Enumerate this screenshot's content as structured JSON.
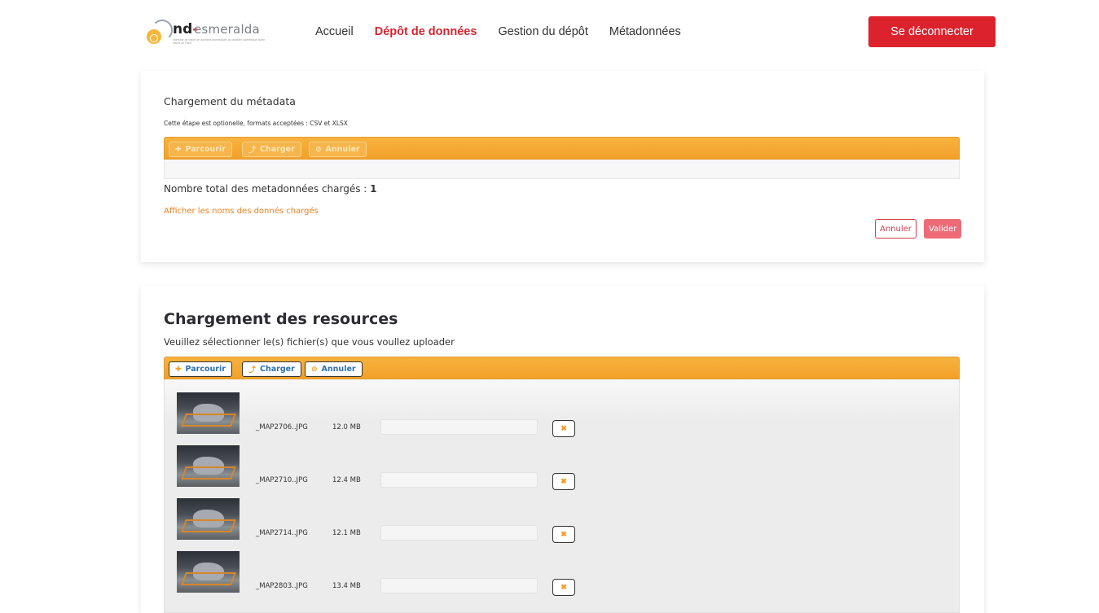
{
  "header": {
    "logo": {
      "prefix": "nd",
      "dash": "-",
      "name": "esmeralda",
      "tagline": "Interface de dépôt de données numériques du chantier scientifique Notre-Dame de Paris"
    },
    "nav": [
      {
        "label": "Accueil",
        "active": false
      },
      {
        "label": "Dépôt de données",
        "active": true
      },
      {
        "label": "Gestion du dépôt",
        "active": false
      },
      {
        "label": "Métadonnées",
        "active": false
      }
    ],
    "logout_label": "Se déconnecter"
  },
  "metadata_section": {
    "title": "Chargement du métadata",
    "hint": "Cette étape est optionelle, formats acceptées : CSV et XLSX",
    "toolbar": {
      "browse_label": "Parcourir",
      "upload_label": "Charger",
      "cancel_label": "Annuler"
    },
    "total_label": "Nombre total des metadonnées chargés :",
    "total_count": "1",
    "show_names_link": "Afficher les noms des donnés chargés",
    "cancel_button": "Annuler",
    "validate_button": "Valider"
  },
  "resources_section": {
    "title": "Chargement des resources",
    "hint": "Veuillez sélectionner le(s) fichier(s) que vous voullez uploader",
    "toolbar": {
      "browse_label": "Parcourir",
      "upload_label": "Charger",
      "cancel_label": "Annuler"
    },
    "files": [
      {
        "name": "_MAP2706..JPG",
        "size": "12.0 MB",
        "progress": 0
      },
      {
        "name": "_MAP2710..JPG",
        "size": "12.4 MB",
        "progress": 0
      },
      {
        "name": "_MAP2714..JPG",
        "size": "12.1 MB",
        "progress": 0
      },
      {
        "name": "_MAP2803..JPG",
        "size": "13.4 MB",
        "progress": 0
      }
    ]
  },
  "icons": {
    "browse": "plus-icon",
    "upload": "upload-icon",
    "cancel": "ban-icon",
    "remove": "times-icon"
  },
  "colors": {
    "accent_red": "#dc232d",
    "toolbar_orange": "#f2a12a",
    "link_orange": "#ef7d1a",
    "valider_pink": "#ec6b77"
  }
}
